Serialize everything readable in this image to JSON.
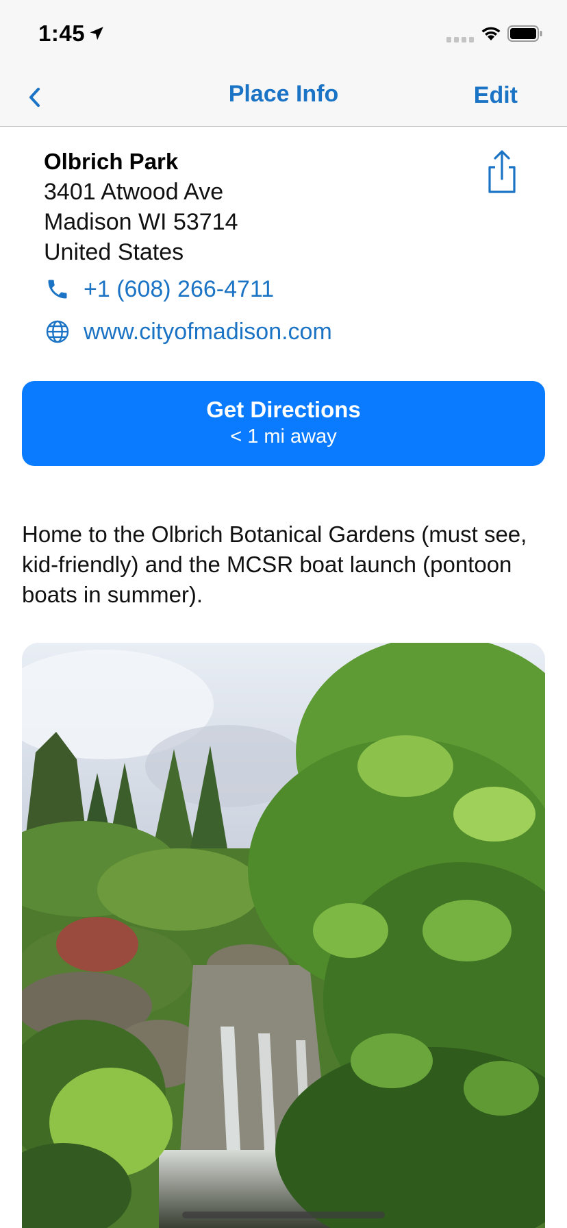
{
  "status_bar": {
    "time": "1:45",
    "icons": [
      "location-arrow-icon",
      "cellular-signal-icon",
      "wifi-icon",
      "battery-icon"
    ]
  },
  "nav": {
    "back_icon": "chevron-left-icon",
    "title": "Place Info",
    "edit_label": "Edit"
  },
  "place": {
    "name": "Olbrich Park",
    "address_line1": "3401 Atwood Ave",
    "address_line2": "Madison WI 53714",
    "address_line3": "United States",
    "phone": "+1 (608) 266-4711",
    "website": "www.cityofmadison.com",
    "share_icon": "share-icon",
    "phone_icon": "phone-icon",
    "website_icon": "globe-icon"
  },
  "directions": {
    "label": "Get Directions",
    "distance": "< 1 mi away"
  },
  "description": "Home to the Olbrich Botanical Gardens (must see, kid-friendly) and the MCSR boat launch (pontoon boats in summer).",
  "colors": {
    "accent": "#1a73c4",
    "button": "#0a7bff",
    "bar_background": "#f7f7f7"
  }
}
